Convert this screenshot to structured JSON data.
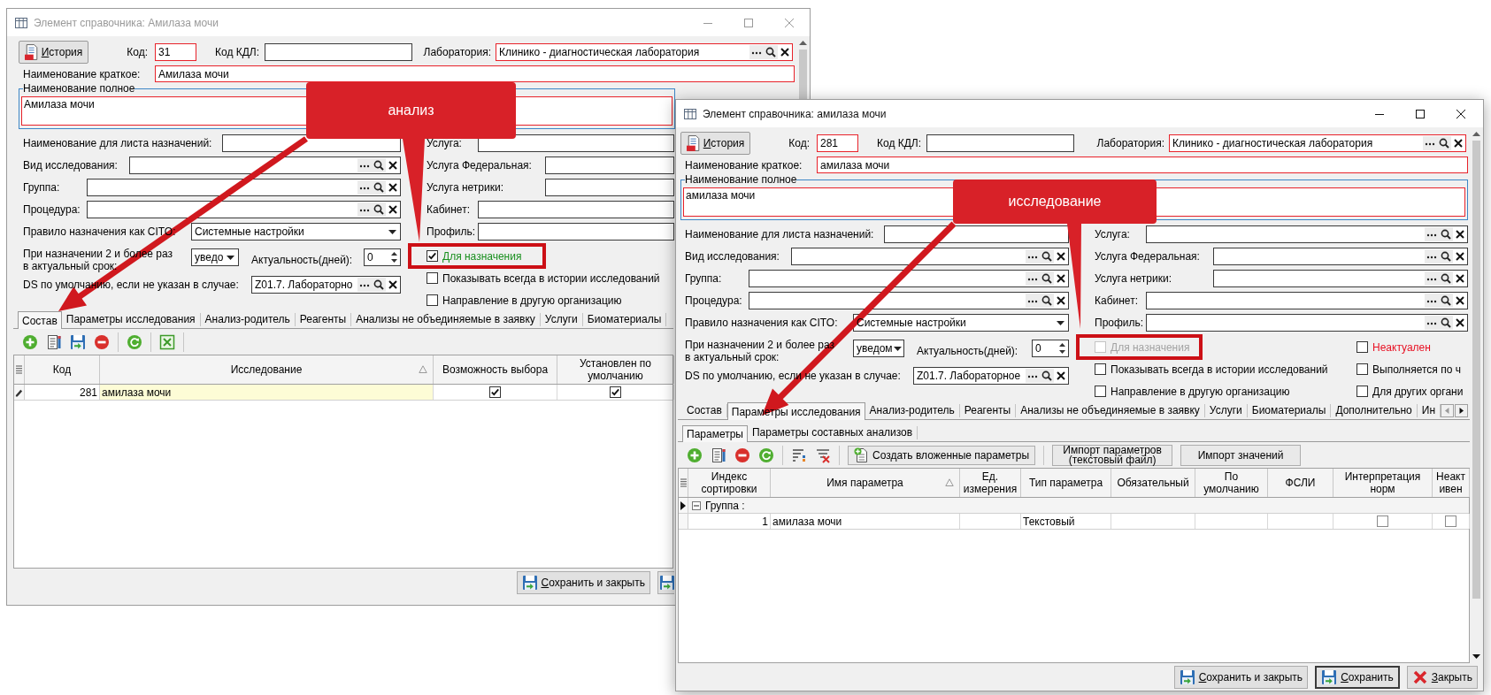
{
  "windows": [
    {
      "title": "Элемент справочника: Амилаза мочи",
      "active": false,
      "history_button": "История",
      "code": {
        "label": "Код:",
        "value": "31",
        "required": true
      },
      "kdl_code": {
        "label": "Код КДЛ:",
        "required": false
      },
      "laboratory": {
        "label": "Лаборатория:",
        "value": "Клинико - диагностическая лаборатория",
        "required": true
      },
      "short_name": {
        "label": "Наименование краткое:",
        "value": "Амилаза мочи",
        "required": true
      },
      "full_name": {
        "label": "Наименование полное",
        "value": "Амилаза мочи",
        "required": true
      },
      "left_fields": [
        {
          "kind": "text",
          "label": "Наименование для листа назначений:"
        },
        {
          "kind": "lookup",
          "label": "Вид исследования:"
        },
        {
          "kind": "lookup",
          "label": "Группа:"
        },
        {
          "kind": "lookup",
          "label": "Процедура:"
        },
        {
          "kind": "dropdown",
          "label": "Правило назначения как CITO:",
          "value": "Системные настройки"
        }
      ],
      "repeat_rule": {
        "label": "При назначении 2 и более раз в актуальный срок:",
        "value": "уведо"
      },
      "relevance": {
        "label": "Актуальность(дней):",
        "value": "0"
      },
      "default_ds": {
        "label": "DS по умолчанию, если не указан в случае:",
        "value": "Z01.7. Лабораторно"
      },
      "right_fields": [
        {
          "kind": "text",
          "label": "Услуга:"
        },
        {
          "kind": "text",
          "label": "Услуга Федеральная:"
        },
        {
          "kind": "text",
          "label": "Услуга нетрики:"
        },
        {
          "kind": "text",
          "label": "Кабинет:"
        },
        {
          "kind": "text",
          "label": "Профиль:"
        }
      ],
      "checkboxes": [
        {
          "label": "Для назначения",
          "checked": true,
          "disabled": false,
          "highlighted": true,
          "color": "#198f1e"
        },
        {
          "label": "Показывать всегда в истории исследований",
          "checked": false,
          "disabled": false,
          "highlighted": false,
          "color": "#000000"
        },
        {
          "label": "Направление в другую организацию",
          "checked": false,
          "disabled": false,
          "highlighted": false,
          "color": "#000000"
        }
      ],
      "tabs": [
        {
          "label": "Состав",
          "selected": true
        },
        {
          "label": "Параметры исследования",
          "selected": false
        },
        {
          "label": "Анализ-родитель",
          "selected": false
        },
        {
          "label": "Реагенты",
          "selected": false
        },
        {
          "label": "Анализы не объединяемые в заявку",
          "selected": false
        },
        {
          "label": "Услуги",
          "selected": false
        },
        {
          "label": "Биоматериалы",
          "selected": false
        }
      ],
      "toolbar": [
        {
          "kind": "add"
        },
        {
          "kind": "edit"
        },
        {
          "kind": "save"
        },
        {
          "kind": "delete"
        },
        {
          "kind": "separator"
        },
        {
          "kind": "refresh"
        },
        {
          "kind": "separator"
        },
        {
          "kind": "excel"
        },
        {
          "kind": "separator"
        }
      ],
      "table": {
        "columns": [
          {
            "label": "Код",
            "kind": "number",
            "sorted": false
          },
          {
            "label": "Исследование",
            "kind": "text",
            "sorted": true
          },
          {
            "label": "Возможность выбора",
            "kind": "check",
            "sorted": false
          },
          {
            "label": "Установлен по умолчанию",
            "kind": "check",
            "sorted": false
          }
        ],
        "rows": [
          {
            "kind": "item",
            "editing": true,
            "cells": [
              {
                "text": "281",
                "focused": false
              },
              {
                "text": "амилаза мочи",
                "focused": true
              },
              {
                "checked": true
              },
              {
                "checked": true
              }
            ]
          }
        ]
      },
      "buttons": [
        {
          "kind": "save_close",
          "label": "Сохранить и закрыть",
          "default": false
        },
        {
          "kind": "save",
          "default": false
        }
      ]
    },
    {
      "title": "Элемент справочника: амилаза мочи",
      "active": true,
      "history_button": "История",
      "code": {
        "label": "Код:",
        "value": "281",
        "required": true
      },
      "kdl_code": {
        "label": "Код КДЛ:",
        "required": false
      },
      "laboratory": {
        "label": "Лаборатория:",
        "value": "Клинико - диагностическая лаборатория",
        "required": true
      },
      "short_name": {
        "label": "Наименование краткое:",
        "value": "амилаза мочи",
        "required": true
      },
      "full_name": {
        "label": "Наименование полное",
        "value": "амилаза мочи",
        "required": true
      },
      "left_fields": [
        {
          "kind": "text",
          "label": "Наименование для листа назначений:"
        },
        {
          "kind": "lookup",
          "label": "Вид исследования:"
        },
        {
          "kind": "lookup",
          "label": "Группа:"
        },
        {
          "kind": "lookup",
          "label": "Процедура:"
        },
        {
          "kind": "dropdown",
          "label": "Правило назначения как CITO:",
          "value": "Системные настройки"
        }
      ],
      "repeat_rule": {
        "label": "При назначении 2 и более раз в актуальный срок:",
        "value": "уведом"
      },
      "relevance": {
        "label": "Актуальность(дней):",
        "value": "0"
      },
      "default_ds": {
        "label": "DS по умолчанию, если не указан в случае:",
        "value": "Z01.7. Лабораторное"
      },
      "right_fields": [
        {
          "kind": "lookup",
          "label": "Услуга:"
        },
        {
          "kind": "lookup",
          "label": "Услуга Федеральная:"
        },
        {
          "kind": "lookup",
          "label": "Услуга нетрики:"
        },
        {
          "kind": "lookup",
          "label": "Кабинет:"
        },
        {
          "kind": "lookup",
          "label": "Профиль:"
        }
      ],
      "checkboxes": [
        {
          "label": "Для назначения",
          "checked": false,
          "disabled": true,
          "highlighted": true
        },
        {
          "label": "Показывать всегда в истории исследований",
          "checked": false,
          "disabled": false,
          "highlighted": false,
          "color": "#000000"
        },
        {
          "label": "Направление в другую организацию",
          "checked": false,
          "disabled": false,
          "highlighted": false,
          "color": "#000000"
        }
      ],
      "flags": [
        {
          "label": "Неактуален",
          "checked": false,
          "color": "#e81123"
        },
        {
          "label": "Выполняется по ч",
          "checked": false,
          "color": "#000000"
        },
        {
          "label": "Для других органи",
          "checked": false,
          "color": "#000000"
        }
      ],
      "tabs": [
        {
          "label": "Состав",
          "selected": false
        },
        {
          "label": "Параметры исследования",
          "selected": true
        },
        {
          "label": "Анализ-родитель",
          "selected": false
        },
        {
          "label": "Реагенты",
          "selected": false
        },
        {
          "label": "Анализы не объединяемые в заявку",
          "selected": false
        },
        {
          "label": "Услуги",
          "selected": false
        },
        {
          "label": "Биоматериалы",
          "selected": false
        },
        {
          "label": "Дополнительно",
          "selected": false
        },
        {
          "label": "Ин",
          "selected": false
        }
      ],
      "tabs_overflow": true,
      "subtabs": [
        {
          "label": "Параметры",
          "selected": true
        },
        {
          "label": "Параметры составных анализов",
          "selected": false
        }
      ],
      "toolbar": [
        {
          "kind": "add"
        },
        {
          "kind": "edit"
        },
        {
          "kind": "delete"
        },
        {
          "kind": "refresh"
        },
        {
          "kind": "separator"
        },
        {
          "kind": "sort"
        },
        {
          "kind": "filter_clear"
        },
        {
          "kind": "separator"
        },
        {
          "kind": "create_button",
          "label": "Создать вложенные параметры"
        },
        {
          "kind": "separator"
        },
        {
          "kind": "text_button",
          "label": "Импорт параметров (текстовый файл)"
        },
        {
          "kind": "text_button",
          "label": "Импорт значений"
        }
      ],
      "table": {
        "columns": [
          {
            "label": "Индекс сортировки",
            "kind": "number",
            "sorted": false
          },
          {
            "label": "Имя параметра",
            "kind": "text",
            "sorted": true
          },
          {
            "label": "Ед. измерения",
            "kind": "text",
            "sorted": false
          },
          {
            "label": "Тип параметра",
            "kind": "text",
            "sorted": false
          },
          {
            "label": "Обязательный",
            "kind": "text",
            "sorted": false
          },
          {
            "label": "По умолчанию",
            "kind": "text",
            "sorted": false
          },
          {
            "label": "ФСЛИ",
            "kind": "text",
            "sorted": false
          },
          {
            "label": "Интерпретация норм",
            "kind": "check",
            "sorted": false
          },
          {
            "label": "Неактивен",
            "kind": "check",
            "sorted": false
          }
        ],
        "rows": [
          {
            "kind": "group",
            "current": true,
            "editing": false,
            "expanded": true,
            "label": "Группа :"
          },
          {
            "kind": "item",
            "current": false,
            "editing": false,
            "cells": [
              {
                "text": "1",
                "focused": false
              },
              {
                "text": "амилаза мочи",
                "focused": false
              },
              {},
              {
                "text": "Текстовый",
                "focused": false
              },
              {},
              {},
              {},
              {
                "checked": false
              },
              {
                "checked": false
              }
            ]
          }
        ]
      },
      "buttons": [
        {
          "kind": "save_close",
          "label": "Сохранить и закрыть",
          "default": false
        },
        {
          "kind": "save",
          "label": "Сохранить",
          "default": true
        },
        {
          "kind": "close",
          "label": "Закрыть",
          "default": false
        }
      ]
    }
  ],
  "callouts": [
    {
      "text": "анализ"
    },
    {
      "text": "исследование"
    }
  ]
}
